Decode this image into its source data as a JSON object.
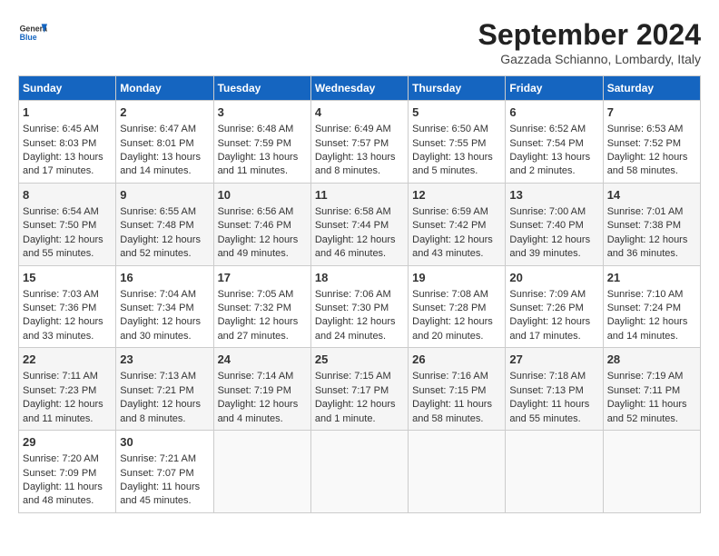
{
  "header": {
    "logo_general": "General",
    "logo_blue": "Blue",
    "month_title": "September 2024",
    "location": "Gazzada Schianno, Lombardy, Italy"
  },
  "days_of_week": [
    "Sunday",
    "Monday",
    "Tuesday",
    "Wednesday",
    "Thursday",
    "Friday",
    "Saturday"
  ],
  "weeks": [
    [
      {
        "day": "1",
        "sunrise": "Sunrise: 6:45 AM",
        "sunset": "Sunset: 8:03 PM",
        "daylight": "Daylight: 13 hours and 17 minutes."
      },
      {
        "day": "2",
        "sunrise": "Sunrise: 6:47 AM",
        "sunset": "Sunset: 8:01 PM",
        "daylight": "Daylight: 13 hours and 14 minutes."
      },
      {
        "day": "3",
        "sunrise": "Sunrise: 6:48 AM",
        "sunset": "Sunset: 7:59 PM",
        "daylight": "Daylight: 13 hours and 11 minutes."
      },
      {
        "day": "4",
        "sunrise": "Sunrise: 6:49 AM",
        "sunset": "Sunset: 7:57 PM",
        "daylight": "Daylight: 13 hours and 8 minutes."
      },
      {
        "day": "5",
        "sunrise": "Sunrise: 6:50 AM",
        "sunset": "Sunset: 7:55 PM",
        "daylight": "Daylight: 13 hours and 5 minutes."
      },
      {
        "day": "6",
        "sunrise": "Sunrise: 6:52 AM",
        "sunset": "Sunset: 7:54 PM",
        "daylight": "Daylight: 13 hours and 2 minutes."
      },
      {
        "day": "7",
        "sunrise": "Sunrise: 6:53 AM",
        "sunset": "Sunset: 7:52 PM",
        "daylight": "Daylight: 12 hours and 58 minutes."
      }
    ],
    [
      {
        "day": "8",
        "sunrise": "Sunrise: 6:54 AM",
        "sunset": "Sunset: 7:50 PM",
        "daylight": "Daylight: 12 hours and 55 minutes."
      },
      {
        "day": "9",
        "sunrise": "Sunrise: 6:55 AM",
        "sunset": "Sunset: 7:48 PM",
        "daylight": "Daylight: 12 hours and 52 minutes."
      },
      {
        "day": "10",
        "sunrise": "Sunrise: 6:56 AM",
        "sunset": "Sunset: 7:46 PM",
        "daylight": "Daylight: 12 hours and 49 minutes."
      },
      {
        "day": "11",
        "sunrise": "Sunrise: 6:58 AM",
        "sunset": "Sunset: 7:44 PM",
        "daylight": "Daylight: 12 hours and 46 minutes."
      },
      {
        "day": "12",
        "sunrise": "Sunrise: 6:59 AM",
        "sunset": "Sunset: 7:42 PM",
        "daylight": "Daylight: 12 hours and 43 minutes."
      },
      {
        "day": "13",
        "sunrise": "Sunrise: 7:00 AM",
        "sunset": "Sunset: 7:40 PM",
        "daylight": "Daylight: 12 hours and 39 minutes."
      },
      {
        "day": "14",
        "sunrise": "Sunrise: 7:01 AM",
        "sunset": "Sunset: 7:38 PM",
        "daylight": "Daylight: 12 hours and 36 minutes."
      }
    ],
    [
      {
        "day": "15",
        "sunrise": "Sunrise: 7:03 AM",
        "sunset": "Sunset: 7:36 PM",
        "daylight": "Daylight: 12 hours and 33 minutes."
      },
      {
        "day": "16",
        "sunrise": "Sunrise: 7:04 AM",
        "sunset": "Sunset: 7:34 PM",
        "daylight": "Daylight: 12 hours and 30 minutes."
      },
      {
        "day": "17",
        "sunrise": "Sunrise: 7:05 AM",
        "sunset": "Sunset: 7:32 PM",
        "daylight": "Daylight: 12 hours and 27 minutes."
      },
      {
        "day": "18",
        "sunrise": "Sunrise: 7:06 AM",
        "sunset": "Sunset: 7:30 PM",
        "daylight": "Daylight: 12 hours and 24 minutes."
      },
      {
        "day": "19",
        "sunrise": "Sunrise: 7:08 AM",
        "sunset": "Sunset: 7:28 PM",
        "daylight": "Daylight: 12 hours and 20 minutes."
      },
      {
        "day": "20",
        "sunrise": "Sunrise: 7:09 AM",
        "sunset": "Sunset: 7:26 PM",
        "daylight": "Daylight: 12 hours and 17 minutes."
      },
      {
        "day": "21",
        "sunrise": "Sunrise: 7:10 AM",
        "sunset": "Sunset: 7:24 PM",
        "daylight": "Daylight: 12 hours and 14 minutes."
      }
    ],
    [
      {
        "day": "22",
        "sunrise": "Sunrise: 7:11 AM",
        "sunset": "Sunset: 7:23 PM",
        "daylight": "Daylight: 12 hours and 11 minutes."
      },
      {
        "day": "23",
        "sunrise": "Sunrise: 7:13 AM",
        "sunset": "Sunset: 7:21 PM",
        "daylight": "Daylight: 12 hours and 8 minutes."
      },
      {
        "day": "24",
        "sunrise": "Sunrise: 7:14 AM",
        "sunset": "Sunset: 7:19 PM",
        "daylight": "Daylight: 12 hours and 4 minutes."
      },
      {
        "day": "25",
        "sunrise": "Sunrise: 7:15 AM",
        "sunset": "Sunset: 7:17 PM",
        "daylight": "Daylight: 12 hours and 1 minute."
      },
      {
        "day": "26",
        "sunrise": "Sunrise: 7:16 AM",
        "sunset": "Sunset: 7:15 PM",
        "daylight": "Daylight: 11 hours and 58 minutes."
      },
      {
        "day": "27",
        "sunrise": "Sunrise: 7:18 AM",
        "sunset": "Sunset: 7:13 PM",
        "daylight": "Daylight: 11 hours and 55 minutes."
      },
      {
        "day": "28",
        "sunrise": "Sunrise: 7:19 AM",
        "sunset": "Sunset: 7:11 PM",
        "daylight": "Daylight: 11 hours and 52 minutes."
      }
    ],
    [
      {
        "day": "29",
        "sunrise": "Sunrise: 7:20 AM",
        "sunset": "Sunset: 7:09 PM",
        "daylight": "Daylight: 11 hours and 48 minutes."
      },
      {
        "day": "30",
        "sunrise": "Sunrise: 7:21 AM",
        "sunset": "Sunset: 7:07 PM",
        "daylight": "Daylight: 11 hours and 45 minutes."
      },
      {
        "day": "",
        "sunrise": "",
        "sunset": "",
        "daylight": ""
      },
      {
        "day": "",
        "sunrise": "",
        "sunset": "",
        "daylight": ""
      },
      {
        "day": "",
        "sunrise": "",
        "sunset": "",
        "daylight": ""
      },
      {
        "day": "",
        "sunrise": "",
        "sunset": "",
        "daylight": ""
      },
      {
        "day": "",
        "sunrise": "",
        "sunset": "",
        "daylight": ""
      }
    ]
  ]
}
